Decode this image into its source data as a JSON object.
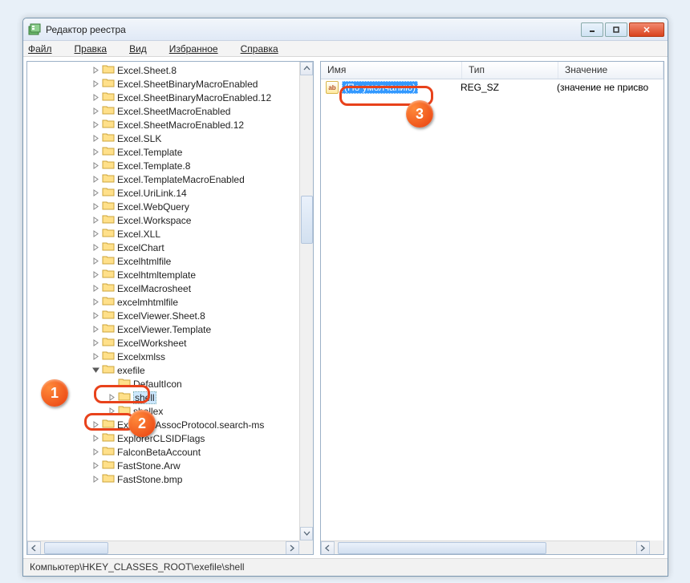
{
  "window": {
    "title": "Редактор реестра"
  },
  "menu": {
    "file": "Файл",
    "edit": "Правка",
    "view": "Вид",
    "favorites": "Избранное",
    "help": "Справка"
  },
  "columns": {
    "name": "Имя",
    "type": "Тип",
    "data": "Значение"
  },
  "tree": {
    "items": [
      {
        "label": "Excel.Sheet.8",
        "indent": 80
      },
      {
        "label": "Excel.SheetBinaryMacroEnabled",
        "indent": 80
      },
      {
        "label": "Excel.SheetBinaryMacroEnabled.12",
        "indent": 80
      },
      {
        "label": "Excel.SheetMacroEnabled",
        "indent": 80
      },
      {
        "label": "Excel.SheetMacroEnabled.12",
        "indent": 80
      },
      {
        "label": "Excel.SLK",
        "indent": 80
      },
      {
        "label": "Excel.Template",
        "indent": 80
      },
      {
        "label": "Excel.Template.8",
        "indent": 80
      },
      {
        "label": "Excel.TemplateMacroEnabled",
        "indent": 80
      },
      {
        "label": "Excel.UriLink.14",
        "indent": 80
      },
      {
        "label": "Excel.WebQuery",
        "indent": 80
      },
      {
        "label": "Excel.Workspace",
        "indent": 80
      },
      {
        "label": "Excel.XLL",
        "indent": 80
      },
      {
        "label": "ExcelChart",
        "indent": 80
      },
      {
        "label": "Excelhtmlfile",
        "indent": 80
      },
      {
        "label": "Excelhtmltemplate",
        "indent": 80
      },
      {
        "label": "ExcelMacrosheet",
        "indent": 80
      },
      {
        "label": "excelmhtmlfile",
        "indent": 80
      },
      {
        "label": "ExcelViewer.Sheet.8",
        "indent": 80
      },
      {
        "label": "ExcelViewer.Template",
        "indent": 80
      },
      {
        "label": "ExcelWorksheet",
        "indent": 80
      },
      {
        "label": "Excelxmlss",
        "indent": 80
      },
      {
        "label": "exefile",
        "indent": 80,
        "expanded": true
      },
      {
        "label": "DefaultIcon",
        "indent": 100,
        "noexpander": true
      },
      {
        "label": "shell",
        "indent": 100,
        "selected": true
      },
      {
        "label": "shellex",
        "indent": 100
      },
      {
        "label": "Explorer.AssocProtocol.search-ms",
        "indent": 80
      },
      {
        "label": "ExplorerCLSIDFlags",
        "indent": 80
      },
      {
        "label": "FalconBetaAccount",
        "indent": 80
      },
      {
        "label": "FastStone.Arw",
        "indent": 80
      },
      {
        "label": "FastStone.bmp",
        "indent": 80
      }
    ]
  },
  "values": {
    "row1": {
      "name": "(По умолчанию)",
      "type": "REG_SZ",
      "data": "(значение не присво"
    }
  },
  "statusbar": "Компьютер\\HKEY_CLASSES_ROOT\\exefile\\shell",
  "callouts": {
    "c1": "1",
    "c2": "2",
    "c3": "3"
  }
}
